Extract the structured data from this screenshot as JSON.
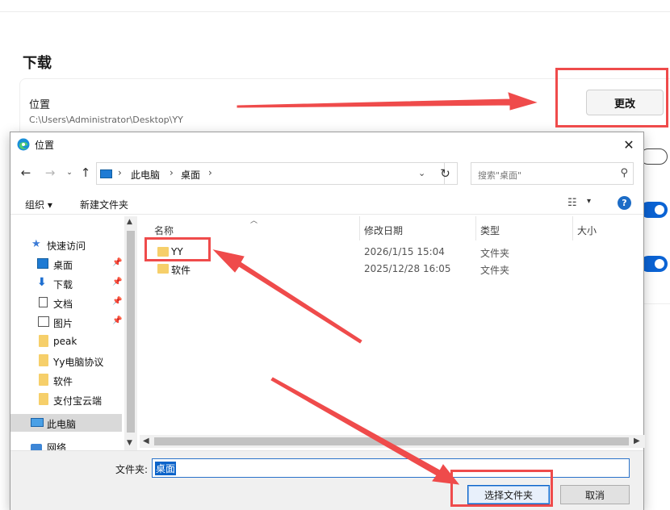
{
  "settings": {
    "section_title": "下载",
    "location_label": "位置",
    "location_path": "C:\\Users\\Administrator\\Desktop\\YY",
    "change_button": "更改",
    "toggles": [
      "off",
      "on",
      "on"
    ]
  },
  "dialog": {
    "title": "位置",
    "close": "✕",
    "address": {
      "crumbs": [
        "此电脑",
        "桌面"
      ],
      "separator": "›"
    },
    "search_placeholder": "搜索\"桌面\"",
    "toolbar": {
      "organize": "组织 ▾",
      "new_folder": "新建文件夹",
      "help": "?"
    },
    "nav": {
      "quick_access": "快速访问",
      "items": [
        {
          "label": "桌面",
          "icon": "desktop-icon",
          "pinned": true
        },
        {
          "label": "下载",
          "icon": "download-icon",
          "pinned": true
        },
        {
          "label": "文档",
          "icon": "document-icon",
          "pinned": true
        },
        {
          "label": "图片",
          "icon": "picture-icon",
          "pinned": true
        },
        {
          "label": "peak",
          "icon": "folder-icon",
          "pinned": false
        },
        {
          "label": "Yy电脑协议",
          "icon": "folder-icon",
          "pinned": false
        },
        {
          "label": "软件",
          "icon": "folder-icon",
          "pinned": false
        },
        {
          "label": "支付宝云端",
          "icon": "folder-icon",
          "pinned": false
        }
      ],
      "this_pc": "此电脑",
      "network": "网络"
    },
    "columns": {
      "name": "名称",
      "modified": "修改日期",
      "type": "类型",
      "size": "大小"
    },
    "files": [
      {
        "name": "YY",
        "modified": "2026/1/15 15:04",
        "type": "文件夹"
      },
      {
        "name": "软件",
        "modified": "2025/12/28 16:05",
        "type": "文件夹"
      }
    ],
    "folder_label": "文件夹:",
    "folder_value": "桌面",
    "select_button": "选择文件夹",
    "cancel_button": "取消"
  },
  "annotation_color": "#ef4b4b",
  "accent_color": "#0b63d4"
}
